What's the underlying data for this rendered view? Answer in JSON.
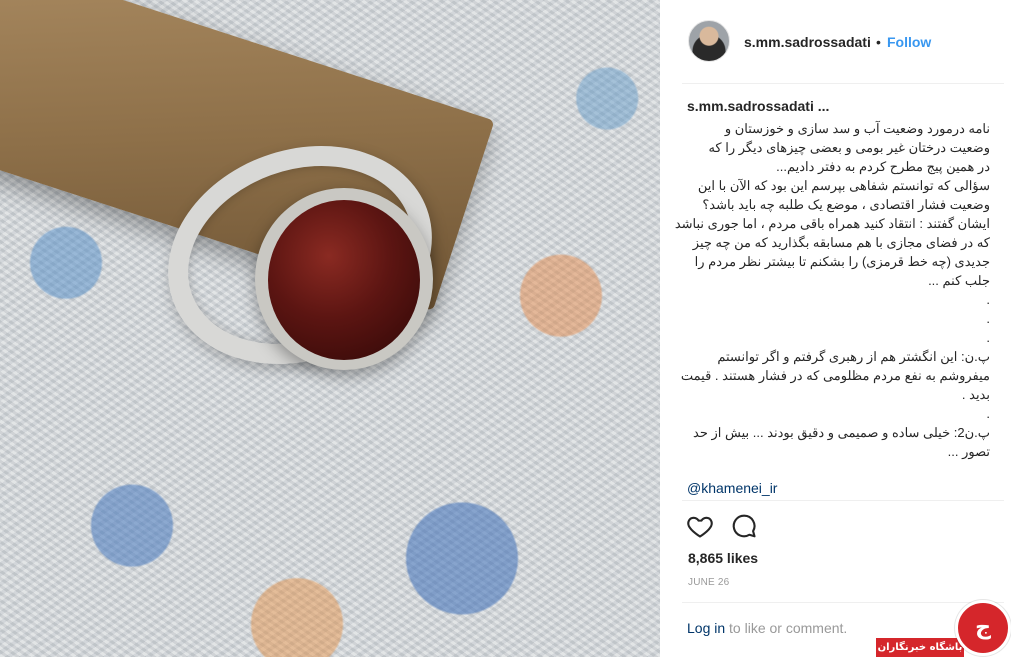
{
  "post": {
    "username": "s.mm.sadrossadati",
    "dot": "•",
    "follow_label": "Follow",
    "caption_user": "s.mm.sadrossadati ...",
    "caption_lines": [
      "نامه درمورد وضعیت آب و سد سازی و خوزستان و",
      "وضعیت درختان غیر بومی و بعضی چیزهای دیگر را که",
      "در همین پیج مطرح کردم به دفتر دادیم...",
      "سؤالی که توانستم شفاهی بپرسم این بود که الآن با این",
      "وضعیت فشار اقتصادی ، موضع یک طلبه چه باید باشد؟",
      "ایشان گفتند : انتقاد کنید همراه باقی مردم ، اما جوری نباشد",
      "که در فضای مجازی با هم مسابقه بگذارید که من چه چیز",
      "جدیدی (چه خط قرمزی) را بشکنم تا بیشتر نظر مردم را",
      "جلب کنم ...",
      ".",
      ".",
      ".",
      "پ.ن: این انگشتر هم از رهبری گرفتم و اگر توانستم",
      "میفروشم به نفع مردم مظلومی که در فشار هستند . قیمت",
      "بدید .",
      ".",
      "پ.ن2: خیلی ساده و صمیمی و دقیق بودند ... بیش از حد",
      "تصور ..."
    ],
    "mention": "@khamenei_ir",
    "likes": "8,865 likes",
    "date": "JUNE 26",
    "login_link": "Log in",
    "login_rest": " to like or comment."
  },
  "icons": {
    "like": "heart-icon",
    "comment": "comment-icon"
  },
  "watermark": {
    "badge_text": "ج",
    "bar_text": "باشگاه خبرنگاران"
  },
  "colors": {
    "link": "#3897f0",
    "mention": "#003569",
    "muted": "#999999",
    "watermark": "#d5262b"
  }
}
